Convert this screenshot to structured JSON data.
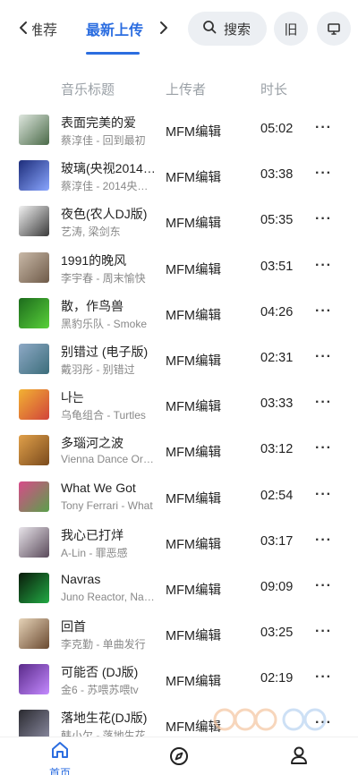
{
  "header": {
    "tab_recommended": "推荐",
    "tab_latest": "最新上传",
    "search_label": "搜索",
    "old_label": "旧"
  },
  "table": {
    "col_title": "音乐标题",
    "col_uploader": "上传者",
    "col_duration": "时长"
  },
  "songs": [
    {
      "title": "表面完美的爱",
      "artist": "蔡淳佳 - 回到最初",
      "uploader": "MFM编辑",
      "duration": "05:02",
      "thumb_colors": [
        "#dfe7df",
        "#4a6a48"
      ]
    },
    {
      "title": "玻璃(央视2014春晚)",
      "artist": "蔡淳佳 - 2014央视春晚",
      "uploader": "MFM编辑",
      "duration": "03:38",
      "thumb_colors": [
        "#1d2d7a",
        "#8aa6ff"
      ]
    },
    {
      "title": "夜色(农人DJ版)",
      "artist": "艺涛, 梁剑东",
      "uploader": "MFM编辑",
      "duration": "05:35",
      "thumb_colors": [
        "#f2f2f2",
        "#3a3a3a"
      ]
    },
    {
      "title": "1991的晚风",
      "artist": "李宇春 - 周末愉快",
      "uploader": "MFM编辑",
      "duration": "03:51",
      "thumb_colors": [
        "#c9b9a8",
        "#6e5a48"
      ]
    },
    {
      "title": "散，作鸟兽",
      "artist": "黑豹乐队 - Smoke",
      "uploader": "MFM编辑",
      "duration": "04:26",
      "thumb_colors": [
        "#1c6b1c",
        "#59d13a"
      ]
    },
    {
      "title": "别错过 (电子版)",
      "artist": "戴羽彤 - 别错过",
      "uploader": "MFM编辑",
      "duration": "02:31",
      "thumb_colors": [
        "#8ea9c6",
        "#3b6d7a"
      ]
    },
    {
      "title": "나는",
      "artist": "乌龟组合 - Turtles",
      "uploader": "MFM编辑",
      "duration": "03:33",
      "thumb_colors": [
        "#f2b233",
        "#d1443a"
      ]
    },
    {
      "title": "多瑙河之波",
      "artist": "Vienna Dance Orchestra",
      "uploader": "MFM编辑",
      "duration": "03:12",
      "thumb_colors": [
        "#e0a04a",
        "#7a4a1c"
      ]
    },
    {
      "title": "What We Got",
      "artist": "Tony Ferrari - What",
      "uploader": "MFM编辑",
      "duration": "02:54",
      "thumb_colors": [
        "#d84a8a",
        "#5aa04a"
      ]
    },
    {
      "title": "我心已打烊",
      "artist": "A-Lin - 罪恶感",
      "uploader": "MFM编辑",
      "duration": "03:17",
      "thumb_colors": [
        "#e8e4ea",
        "#5a4a5a"
      ]
    },
    {
      "title": "Navras",
      "artist": "Juno Reactor, Navras",
      "uploader": "MFM编辑",
      "duration": "09:09",
      "thumb_colors": [
        "#0a1a0a",
        "#22aa44"
      ]
    },
    {
      "title": "回首",
      "artist": "李克勤 - 单曲发行",
      "uploader": "MFM编辑",
      "duration": "03:25",
      "thumb_colors": [
        "#e6d3b8",
        "#6a4a30"
      ]
    },
    {
      "title": "可能否 (DJ版)",
      "artist": "金6 - 苏喂苏喂tv",
      "uploader": "MFM编辑",
      "duration": "02:19",
      "thumb_colors": [
        "#5a2a8a",
        "#c48aff"
      ]
    },
    {
      "title": "落地生花(DJ版)",
      "artist": "韩小欠 - 落地生花",
      "uploader": "MFM编辑",
      "duration": "",
      "thumb_colors": [
        "#2a2a30",
        "#8a8aa0"
      ]
    }
  ],
  "bottom_nav": {
    "home_label": "首页",
    "accent_color": "#2b6de0"
  },
  "icons": [
    "chevron-left-icon",
    "chevron-right-icon",
    "search-icon",
    "screen-icon",
    "more-icon",
    "home-icon",
    "compass-icon",
    "profile-icon"
  ]
}
